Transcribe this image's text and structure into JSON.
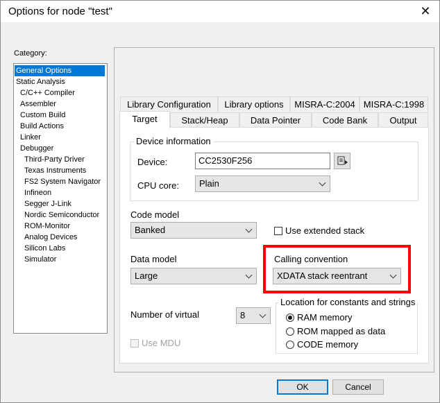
{
  "window": {
    "title": "Options for node \"test\""
  },
  "category": {
    "label": "Category:",
    "items": [
      {
        "label": "General Options",
        "selected": true
      },
      {
        "label": "Static Analysis"
      },
      {
        "label": "C/C++ Compiler"
      },
      {
        "label": "Assembler"
      },
      {
        "label": "Custom Build"
      },
      {
        "label": "Build Actions"
      },
      {
        "label": "Linker"
      },
      {
        "label": "Debugger"
      },
      {
        "label": "Third-Party Driver"
      },
      {
        "label": "Texas Instruments"
      },
      {
        "label": "FS2 System Navigator"
      },
      {
        "label": "Infineon"
      },
      {
        "label": "Segger J-Link"
      },
      {
        "label": "Nordic Semiconductor"
      },
      {
        "label": "ROM-Monitor"
      },
      {
        "label": "Analog Devices"
      },
      {
        "label": "Silicon Labs"
      },
      {
        "label": "Simulator"
      }
    ]
  },
  "tabs": {
    "row1": [
      "Library Configuration",
      "Library options",
      "MISRA-C:2004",
      "MISRA-C:1998"
    ],
    "row2": [
      "Target",
      "Stack/Heap",
      "Data Pointer",
      "Code Bank",
      "Output"
    ],
    "active": "Target"
  },
  "device_info": {
    "title": "Device information",
    "device_label": "Device:",
    "device_value": "CC2530F256",
    "cpu_label": "CPU core:",
    "cpu_value": "Plain"
  },
  "code_model": {
    "label": "Code model",
    "value": "Banked"
  },
  "extended_stack": {
    "label": "Use extended stack",
    "checked": false
  },
  "data_model": {
    "label": "Data model",
    "value": "Large"
  },
  "calling_convention": {
    "label": "Calling convention",
    "value": "XDATA stack reentrant"
  },
  "virtual_regs": {
    "label": "Number of virtual",
    "value": "8"
  },
  "location": {
    "title": "Location for constants and strings",
    "options": [
      "RAM memory",
      "ROM mapped as data",
      "CODE memory"
    ],
    "selected": "RAM memory"
  },
  "mdu": {
    "label": "Use MDU",
    "checked": false,
    "enabled": false
  },
  "buttons": {
    "ok": "OK",
    "cancel": "Cancel"
  },
  "colors": {
    "selection": "#0078d7",
    "highlight": "#ff0000"
  }
}
